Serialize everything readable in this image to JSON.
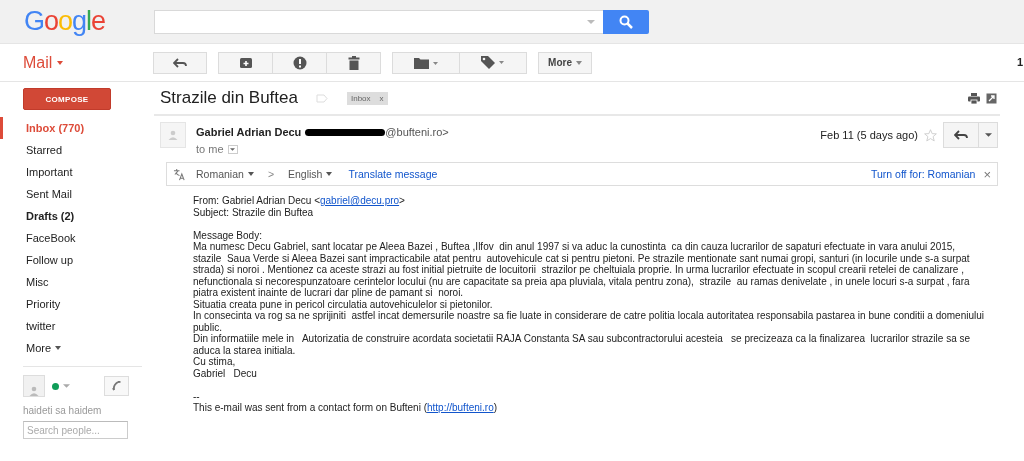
{
  "header": {
    "logo": "Google"
  },
  "toolbar": {
    "app_menu": "Mail",
    "buttons": [
      {
        "kind": "reply"
      },
      {
        "kind": "archive"
      },
      {
        "kind": "spam"
      },
      {
        "kind": "delete"
      },
      {
        "kind": "move"
      },
      {
        "kind": "labels"
      },
      {
        "kind": "more",
        "label": "More"
      }
    ],
    "counter": "1"
  },
  "sidebar": {
    "compose": "COMPOSE",
    "items": [
      {
        "label": "Inbox (770)",
        "selected": true,
        "unread": true
      },
      {
        "label": "Starred",
        "selected": false,
        "unread": false
      },
      {
        "label": "Important",
        "selected": false,
        "unread": false
      },
      {
        "label": "Sent Mail",
        "selected": false,
        "unread": false
      },
      {
        "label": "Drafts (2)",
        "selected": false,
        "unread": true
      },
      {
        "label": "FaceBook",
        "selected": false,
        "unread": false
      },
      {
        "label": "Follow up",
        "selected": false,
        "unread": false
      },
      {
        "label": "Misc",
        "selected": false,
        "unread": false
      },
      {
        "label": "Priority",
        "selected": false,
        "unread": false
      },
      {
        "label": "twitter",
        "selected": false,
        "unread": false
      },
      {
        "label": "More",
        "selected": false,
        "unread": false
      }
    ],
    "chat": {
      "available": true,
      "name": "haideti sa haidem",
      "search_placeholder": "Search people..."
    }
  },
  "thread": {
    "subject": "Strazile din Buftea",
    "labels": [
      {
        "label": "Inbox",
        "remove": "x"
      }
    ],
    "message": {
      "sender": "Gabriel Adrian Decu",
      "sender_email": "@bufteni.ro>",
      "recipient": "to me",
      "date": "Feb 11 (5 days ago)",
      "starred": false,
      "translate": {
        "from": "Romanian",
        "arrow": ">",
        "to": "English",
        "action": "Translate message",
        "turn_off": "Turn off for: Romanian",
        "close": "×"
      },
      "body": {
        "from_prefix": "From: Gabriel Adrian Decu <",
        "from_email": "gabriel@decu.pro",
        "from_suffix": ">",
        "subject": "Subject: Strazile din Buftea",
        "heading": "Message Body:",
        "lines": [
          "Ma numesc Decu Gabriel, sant locatar pe Aleea Bazei , Buftea ,Ilfov  din anul 1997 si va aduc la cunostinta  ca din cauza lucrarilor de sapaturi efectuate in vara anului 2015,",
          "stazile  Saua Verde si Aleea Bazei sant impracticabile atat pentru  autovehicule cat si pentru pietoni. Pe strazile mentionate sant numai gropi, santuri (in locurile unde s-a surpat",
          "strada) si noroi . Mentionez ca aceste strazi au fost initial pietruite de locuitorii  strazilor pe cheltuiala proprie. In urma lucrarilor efectuate in scopul crearii retelei de canalizare ,",
          "nefunctionala si necorespunzatoare cerintelor locului (nu are capacitate sa preia apa pluviala, vitala pentru zona),  strazile  au ramas denivelate , in unele locuri s-a surpat , fara",
          "piatra existent inainte de lucrari dar pline de pamant si  noroi.",
          "Situatia creata pune in pericol circulatia autovehiculelor si pietonilor.",
          "In consecinta va rog sa ne sprijiniti  astfel incat demersurile noastre sa fie luate in considerare de catre politia locala autoritatea responsabila pastarea in bune conditii a domeniului",
          "public.",
          "Din informatiile mele in   Autorizatia de construire acordata societatii RAJA Constanta SA sau subcontractorului acesteia   se precizeaza ca la finalizarea  lucrarilor strazile sa se",
          "aduca la starea initiala.",
          "Cu stima,",
          "Gabriel   Decu"
        ],
        "separator": "--",
        "footer_prefix": "This e-mail was sent from a contact form on Bufteni (",
        "footer_link": "http://bufteni.ro",
        "footer_suffix": ")"
      }
    }
  }
}
